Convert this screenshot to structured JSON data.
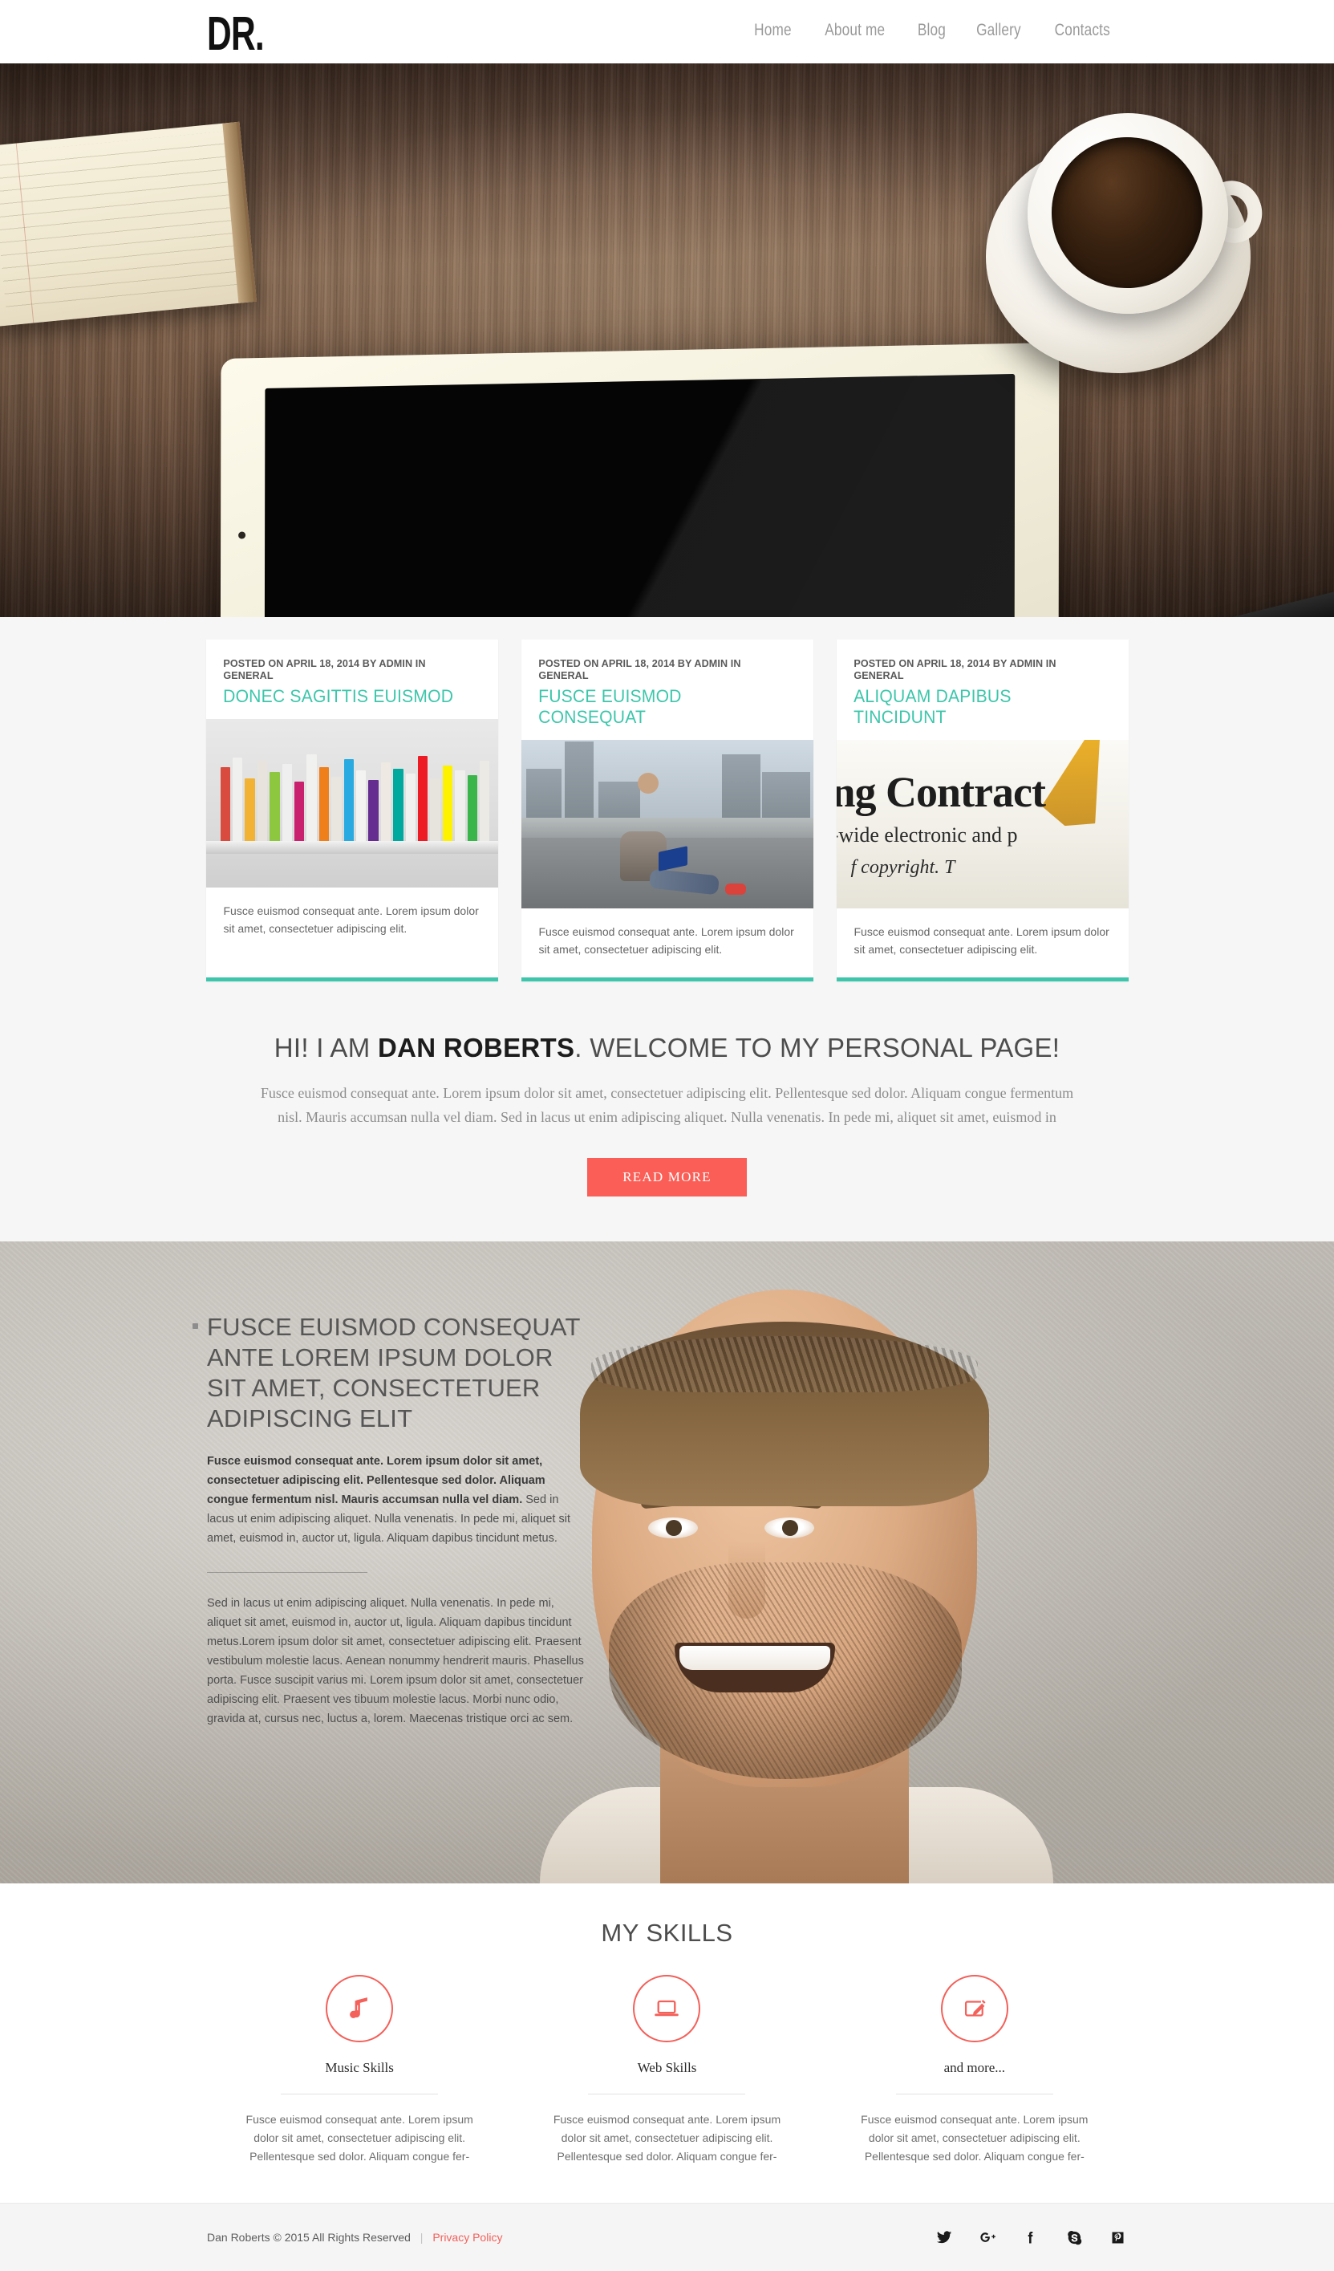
{
  "header": {
    "logo": "DR.",
    "nav": [
      {
        "label": "Home",
        "name": "nav-home"
      },
      {
        "label": "About me",
        "name": "nav-about-me"
      },
      {
        "label": "Blog",
        "name": "nav-blog"
      },
      {
        "label": "Gallery",
        "name": "nav-gallery"
      },
      {
        "label": "Contacts",
        "name": "nav-contacts"
      }
    ]
  },
  "hero": {
    "alt": "desk with notebook, tablet and cup of coffee"
  },
  "posts": [
    {
      "meta": "POSTED ON APRIL 18, 2014 BY ADMIN IN GENERAL",
      "title": "DONEC SAGITTIS EUISMOD",
      "excerpt": "Fusce euismod consequat ante. Lorem ipsum dolor sit amet, consectetuer adipiscing elit.",
      "thumb": "colorful-books-on-shelf"
    },
    {
      "meta": "POSTED ON APRIL 18, 2014 BY ADMIN IN GENERAL",
      "title": "FUSCE EUISMOD CONSEQUAT",
      "excerpt": "Fusce euismod consequat ante. Lorem ipsum dolor sit amet, consectetuer adipiscing elit.",
      "thumb": "man-with-laptop-on-street"
    },
    {
      "meta": "POSTED ON APRIL 18, 2014 BY ADMIN IN GENERAL",
      "title": "ALIQUAM DAPIBUS TINCIDUNT",
      "excerpt": "Fusce euismod consequat ante. Lorem ipsum dolor sit amet, consectetuer adipiscing elit.",
      "thumb": "contract-document-closeup"
    }
  ],
  "welcome": {
    "prefix": "HI! I AM ",
    "name": "DAN ROBERTS",
    "suffix": ". WELCOME TO MY PERSONAL PAGE!",
    "paragraph": "Fusce euismod consequat ante. Lorem ipsum dolor sit amet, consectetuer adipiscing elit. Pellentesque sed dolor. Aliquam congue fermentum nisl. Mauris accumsan nulla vel diam. Sed in lacus ut enim adipiscing aliquet. Nulla venenatis. In pede mi, aliquet sit amet, euismod in",
    "button": "READ MORE"
  },
  "about": {
    "heading": "FUSCE EUISMOD CONSEQUAT ANTE LOREM IPSUM DOLOR SIT AMET, CONSECTETUER ADIPISCING ELIT",
    "paragraph_bold": "Fusce euismod consequat ante. Lorem ipsum dolor sit amet, consectetuer adipiscing elit. Pellentesque sed dolor. Aliquam congue fermentum nisl. Mauris accumsan nulla vel diam.",
    "paragraph_rest": " Sed in lacus ut enim adipiscing aliquet. Nulla venenatis. In pede mi, aliquet sit amet, euismod in, auctor ut, ligula. Aliquam dapibus tincidunt metus.",
    "paragraph_2": " Sed in lacus ut enim adipiscing aliquet. Nulla venenatis. In pede mi, aliquet sit amet, euismod in, auctor ut, ligula. Aliquam dapibus tincidunt metus.Lorem ipsum dolor sit amet, consectetuer adipiscing elit. Praesent vestibulum molestie lacus. Aenean nonummy hendrerit mauris. Phasellus porta. Fusce suscipit varius mi. Lorem ipsum dolor sit amet, consectetuer adipiscing elit. Praesent ves tibuum molestie lacus. Morbi nunc odio, gravida at, cursus nec, luctus a, lorem. Maecenas tristique orci ac sem."
  },
  "skills": {
    "heading": "MY SKILLS",
    "items": [
      {
        "icon": "music-note-icon",
        "label": "Music Skills",
        "text": "Fusce euismod consequat ante. Lorem ipsum dolor sit amet, consectetuer adipiscing elit. Pellentesque sed dolor. Aliquam congue fer-"
      },
      {
        "icon": "laptop-icon",
        "label": "Web Skills",
        "text": "Fusce euismod consequat ante. Lorem ipsum dolor sit amet, consectetuer adipiscing elit. Pellentesque sed dolor. Aliquam congue fer-"
      },
      {
        "icon": "pencil-edit-icon",
        "label": "and more...",
        "text": "Fusce euismod consequat ante. Lorem ipsum dolor sit amet, consectetuer adipiscing elit. Pellentesque sed dolor. Aliquam congue fer-"
      }
    ]
  },
  "footer": {
    "copyright": "Dan Roberts © 2015 All Rights Reserved",
    "separator": "|",
    "privacy": "Privacy Policy",
    "social": [
      {
        "name": "twitter-icon",
        "label": "Twitter"
      },
      {
        "name": "google-plus-icon",
        "label": "Google Plus"
      },
      {
        "name": "facebook-icon",
        "label": "Facebook"
      },
      {
        "name": "skype-icon",
        "label": "Skype"
      },
      {
        "name": "pinterest-icon",
        "label": "Pinterest"
      }
    ]
  },
  "colors": {
    "accent_red": "#f4605a",
    "accent_teal": "#3dc6ab",
    "button_red": "#fa5e56",
    "text_dark": "#2b2b2b"
  }
}
